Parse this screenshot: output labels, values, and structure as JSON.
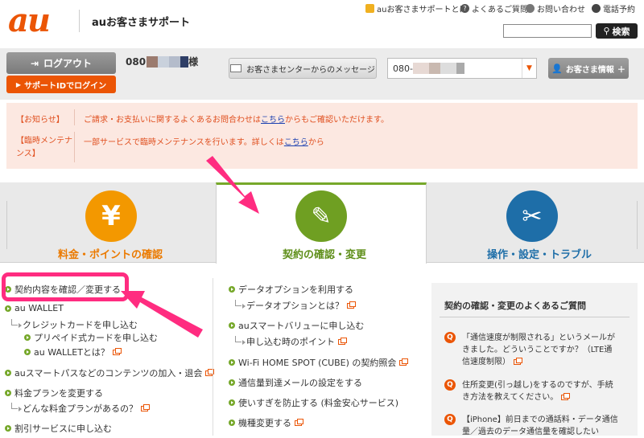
{
  "header": {
    "logo": "au",
    "site_title": "auお客さまサポート",
    "links": [
      {
        "label": "auお客さまサポートとは",
        "icon": "au-support-icon"
      },
      {
        "label": "よくあるご質問",
        "icon": "question-icon"
      },
      {
        "label": "お問い合わせ",
        "icon": "chat-icon"
      },
      {
        "label": "電話予約",
        "icon": "operator-icon"
      }
    ],
    "search_value": "",
    "search_label": "検索"
  },
  "account": {
    "logout_label": "ログアウト",
    "support_id_label": "サポートIDでログイン",
    "number_prefix": "080",
    "honorific": "様",
    "message_label": "お客さまセンターからのメッセージ",
    "line_select_prefix": "080-",
    "info_label": "お客さま情報"
  },
  "notices": [
    {
      "label": "【お知らせ】",
      "text_before": "ご請求・お支払いに関するよくあるお問合わせは",
      "link": "こちら",
      "text_after": "からもご確認いただけます。"
    },
    {
      "label_line1": "【臨時メンテナ",
      "label_line2": "ンス】",
      "text_before": "一部サービスで臨時メンテナンスを行います。詳しくは",
      "link": "こちら",
      "text_after": "から"
    }
  ],
  "tabs": [
    {
      "label": "料金・ポイントの確認",
      "glyph": "¥",
      "color": "#f39800",
      "label_color": "#eb7a00"
    },
    {
      "label": "契約の確認・変更",
      "glyph": "✎",
      "color": "#6f9f22",
      "label_color": "#5f8f1a"
    },
    {
      "label": "操作・設定・トラブル",
      "glyph": "✂",
      "color": "#1e6ea8",
      "label_color": "#1e6ea8"
    }
  ],
  "left_list": {
    "confirm_contract": "契約内容を確認／変更する",
    "au_wallet": "au WALLET",
    "credit_card": "クレジットカードを申し込む",
    "prepaid_card": "プリペイド式カードを申し込む",
    "what_is_wallet": "au WALLETとは？",
    "smartpass": "auスマートパスなどのコンテンツの加入・退会",
    "change_plan": "料金プランを変更する",
    "what_plans": "どんな料金プランがあるの？",
    "discount": "割引サービスに申し込む"
  },
  "mid_list": {
    "data_option": "データオプションを利用する",
    "what_is_data_option": "データオプションとは？",
    "smart_value": "auスマートバリューに申し込む",
    "smart_value_tip": "申し込む時のポイント",
    "wifi": "Wi-Fi HOME SPOT (CUBE) の契約照会",
    "data_mail": "通信量到達メールの設定をする",
    "prevent_overuse": "使いすぎを防止する (料金安心サービス)",
    "change_device": "機種変更する"
  },
  "faq": {
    "title": "契約の確認・変更のよくあるご質問",
    "items": [
      {
        "line1": "「通信速度が制限される」というメールが",
        "line2": "きました。どういうことですか？（LTE通",
        "line3": "信速度制限）"
      },
      {
        "line1": "住所変更(引っ越し)をするのですが、手続",
        "line2": "き方法を教えてください。",
        "line3": ""
      },
      {
        "line1": "【iPhone】前日までの通話料・データ通信",
        "line2": "量／過去のデータ通信量を確認したい",
        "line3": ""
      }
    ]
  },
  "colors": {
    "accent": "#eb5505",
    "green": "#76a82a",
    "annotation": "#ff2c80"
  }
}
